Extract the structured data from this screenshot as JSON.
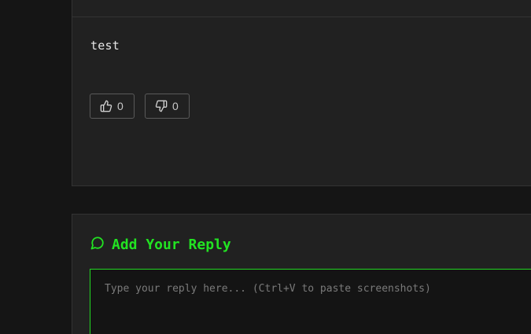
{
  "post": {
    "body": "test",
    "upvotes": "0",
    "downvotes": "0"
  },
  "reply": {
    "title": "Add Your Reply",
    "placeholder": "Type your reply here... (Ctrl+V to paste screenshots)",
    "value": ""
  },
  "icons": {
    "thumbs_up": "thumbs-up-icon",
    "thumbs_down": "thumbs-down-icon",
    "comment": "message-circle-icon"
  },
  "colors": {
    "accent": "#22e322",
    "background": "#151515",
    "card": "#212121"
  }
}
